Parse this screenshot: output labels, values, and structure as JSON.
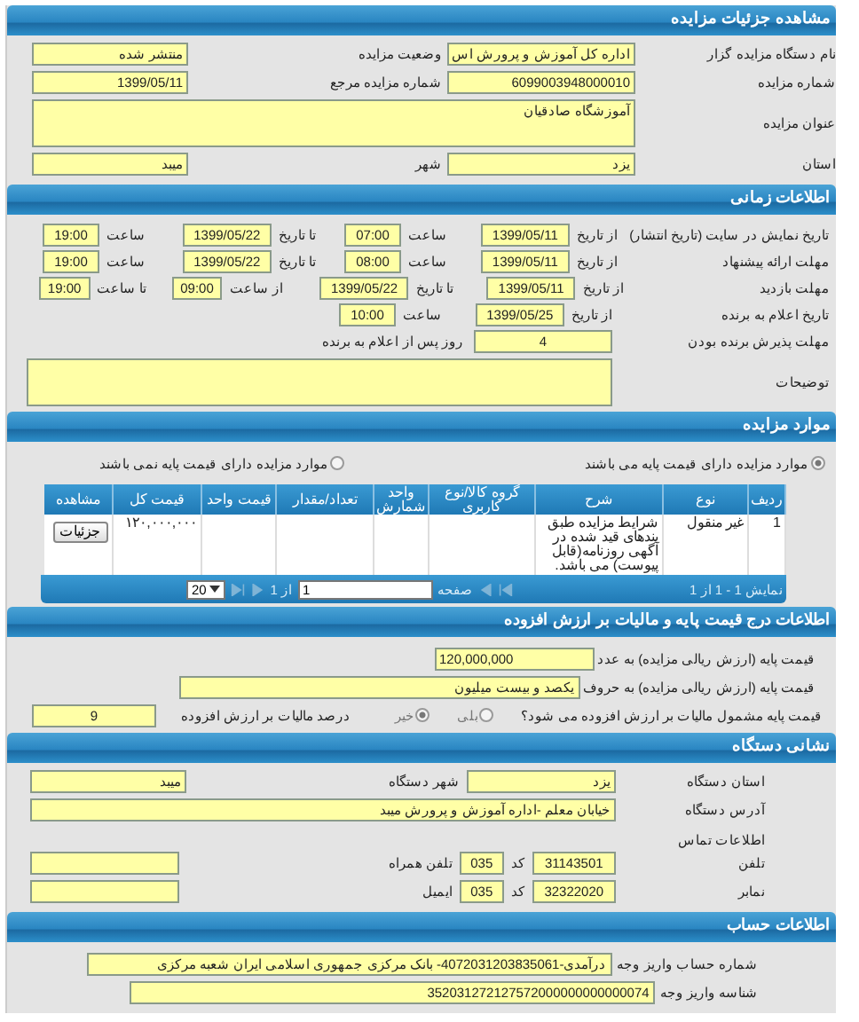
{
  "details": {
    "title": "مشاهده جزئیات مزایده",
    "fields": [
      {
        "label": "نام دستگاه مزایده گزار",
        "value": "اداره کل آموزش و پرورش اس"
      },
      {
        "label": "وضعیت مزایده",
        "value": "منتشر شده"
      },
      {
        "label": "شماره مزایده",
        "value": "6099003948000010"
      },
      {
        "label": "شماره مزایده مرجع",
        "value": "1399/05/11"
      },
      {
        "label": "عنوان مزایده",
        "value": "آموزشگاه صادقیان",
        "kind": "area"
      },
      {
        "label": "استان",
        "value": "یزد"
      },
      {
        "label": "شهر",
        "value": "میبد"
      }
    ]
  },
  "timing": {
    "title": "اطلاعات زمانی",
    "rows": [
      {
        "label": "تاریخ نمایش در سایت (تاریخ انتشار)",
        "cells": [
          {
            "label": "از تاریخ",
            "value": "1399/05/11",
            "kind": "date"
          },
          {
            "label": "ساعت",
            "value": "07:00",
            "kind": "time"
          },
          {
            "label": "تا تاریخ",
            "value": "1399/05/22",
            "kind": "date"
          },
          {
            "label": "ساعت",
            "value": "19:00",
            "kind": "time"
          }
        ]
      },
      {
        "label": "مهلت ارائه پیشنهاد",
        "cells": [
          {
            "label": "از تاریخ",
            "value": "1399/05/11",
            "kind": "date"
          },
          {
            "label": "ساعت",
            "value": "08:00",
            "kind": "time"
          },
          {
            "label": "تا تاریخ",
            "value": "1399/05/22",
            "kind": "date"
          },
          {
            "label": "ساعت",
            "value": "19:00",
            "kind": "time"
          }
        ]
      },
      {
        "label": "مهلت بازدید",
        "cells": [
          {
            "label": "از تاریخ",
            "value": "1399/05/11",
            "kind": "date"
          },
          {
            "label": "تا تاریخ",
            "value": "1399/05/22",
            "kind": "date"
          },
          {
            "label": "از ساعت",
            "value": "09:00",
            "kind": "time"
          },
          {
            "label": "تا ساعت",
            "value": "19:00",
            "kind": "time"
          }
        ]
      },
      {
        "label": "تاریخ اعلام به برنده",
        "cells": [
          {
            "label": "از تاریخ",
            "value": "1399/05/25",
            "kind": "date"
          },
          {
            "label": "ساعت",
            "value": "10:00",
            "kind": "time"
          }
        ]
      }
    ],
    "acceptance": {
      "label": "مهلت پذیرش برنده بودن",
      "value": "4",
      "suffix": "روز پس از اعلام به برنده"
    },
    "notes": {
      "label": "توضیحات"
    }
  },
  "items": {
    "title": "موارد مزایده",
    "options": [
      {
        "label": "موارد مزایده دارای قیمت پایه می باشند",
        "selected": true
      },
      {
        "label": "موارد مزایده دارای قیمت پایه نمی باشند",
        "selected": false
      }
    ],
    "table": {
      "columns": [
        "ردیف",
        "نوع",
        "شرح",
        "گروه کالا/نوع کاربری",
        "واحد شمارش",
        "تعداد/مقدار",
        "قیمت واحد",
        "قیمت کل",
        "مشاهده"
      ],
      "rows": [
        {
          "cells": [
            "1",
            "غیر منقول",
            "شرایط مزایده طبق بندهای قید شده در آگهی روزنامه(قابل پیوست) می باشد.",
            null,
            null,
            null,
            null,
            "۱۲۰,۰۰۰,۰۰۰"
          ],
          "action": "جزئیات"
        }
      ]
    },
    "pager": {
      "summary": "نمایش 1 - 1 از 1",
      "page_label": "صفحه",
      "page": "1",
      "of": "از 1",
      "page_size": "20"
    }
  },
  "pricing": {
    "title": "اطلاعات درج قیمت پایه و مالیات بر ارزش افزوده",
    "fields": [
      {
        "label": "قیمت پایه (ارزش ریالی مزایده) به عدد",
        "value": "120,000,000",
        "kind": "number"
      },
      {
        "label": "قیمت پایه (ارزش ریالی مزایده) به حروف",
        "value": "یکصد و بیست میلیون",
        "kind": "text"
      }
    ],
    "vat_question": {
      "label": "قیمت پایه مشمول مالیات بر ارزش افزوده می شود؟",
      "options": [
        {
          "label": "بلی",
          "selected": false
        },
        {
          "label": "خیر",
          "selected": true
        }
      ]
    },
    "vat_rate": {
      "label": "درصد مالیات بر ارزش افزوده",
      "value": "9"
    }
  },
  "address": {
    "title": "نشانی دستگاه",
    "fields": [
      {
        "label": "استان دستگاه",
        "value": "یزد"
      },
      {
        "label": "شهر دستگاه",
        "value": "میبد"
      },
      {
        "label": "آدرس دستگاه",
        "value": "خیابان معلم -اداره آموزش و پرورش میبد",
        "kind": "wide"
      }
    ],
    "contact_title": "اطلاعات تماس",
    "contacts": [
      {
        "label": "تلفن",
        "value": "31143501",
        "code_label": "کد",
        "code": "035"
      },
      {
        "label": "تلفن همراه"
      },
      {
        "label": "نمابر",
        "value": "32322020",
        "code_label": "کد",
        "code": "035"
      },
      {
        "label": "ایمیل"
      }
    ]
  },
  "account": {
    "title": "اطلاعات حساب",
    "fields": [
      {
        "label": "شماره حساب واریز وجه",
        "value": "درآمدی-4072031203835061- بانک مرکزی جمهوری اسلامی ایران شعبه مرکزی"
      },
      {
        "label": "شناسه واریز وجه",
        "value": "352031272127572000000000000074"
      }
    ]
  }
}
